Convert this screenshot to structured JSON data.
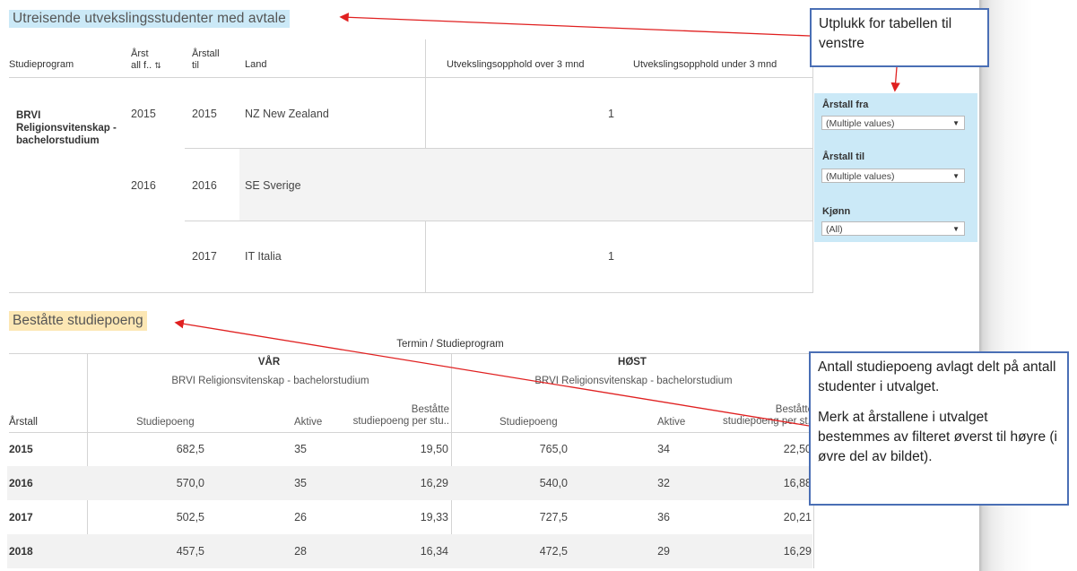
{
  "top": {
    "title": "Utreisende utvekslingsstudenter med avtale",
    "headers": {
      "studieprogram": "Studieprogram",
      "arstall_fra_l1": "Årst",
      "arstall_fra_l2": "all f..",
      "arstall_til_l1": "Årstall",
      "arstall_til_l2": "til",
      "land": "Land",
      "over3": "Utvekslingsopphold over 3 mnd",
      "under3": "Utvekslingsopphold under 3 mnd"
    },
    "program_l1": "BRVI",
    "program_l2": "Religionsvitenskap -",
    "program_l3": "bachelorstudium",
    "rows": [
      {
        "fra": "2015",
        "til": "2015",
        "land": "NZ New Zealand",
        "over3": "1",
        "under3": ""
      },
      {
        "fra": "2016",
        "til": "2016",
        "land": "SE Sverige",
        "over3": "",
        "under3": ""
      },
      {
        "fra": "",
        "til": "2017",
        "land": "IT Italia",
        "over3": "1",
        "under3": ""
      }
    ]
  },
  "filters": {
    "arstall_fra": {
      "label": "Årstall fra",
      "value": "(Multiple values)"
    },
    "arstall_til": {
      "label": "Årstall til",
      "value": "(Multiple values)"
    },
    "kjonn": {
      "label": "Kjønn",
      "value": "(All)"
    }
  },
  "bottom": {
    "title": "Beståtte studiepoeng",
    "super_header": "Termin / Studieprogram",
    "var": "VÅR",
    "host": "HØST",
    "program": "BRVI Religionsvitenskap - bachelorstudium",
    "col_arstall": "Årstall",
    "col_studiepoeng": "Studiepoeng",
    "col_aktive": "Aktive",
    "col_bestatte_l1": "Beståtte",
    "col_bestatte_l2": "studiepoeng per stu..",
    "col_bestatte_l2b": "studiepoeng per st..",
    "rows": [
      {
        "year": "2015",
        "v_sp": "682,5",
        "v_akt": "35",
        "v_per": "19,50",
        "h_sp": "765,0",
        "h_akt": "34",
        "h_per": "22,50"
      },
      {
        "year": "2016",
        "v_sp": "570,0",
        "v_akt": "35",
        "v_per": "16,29",
        "h_sp": "540,0",
        "h_akt": "32",
        "h_per": "16,88"
      },
      {
        "year": "2017",
        "v_sp": "502,5",
        "v_akt": "26",
        "v_per": "19,33",
        "h_sp": "727,5",
        "h_akt": "36",
        "h_per": "20,21"
      },
      {
        "year": "2018",
        "v_sp": "457,5",
        "v_akt": "28",
        "v_per": "16,34",
        "h_sp": "472,5",
        "h_akt": "29",
        "h_per": "16,29"
      }
    ]
  },
  "callouts": {
    "filter_note": "Utplukk for tabellen til venstre",
    "bottom_note_p1": "Antall studiepoeng avlagt delt på antall studenter i utvalget.",
    "bottom_note_p2": "Merk at årstallene i utvalget bestemmes av filteret øverst til høyre (i øvre del av bildet)."
  },
  "colors": {
    "title_blue_bg": "#cbe9f7",
    "title_yellow_bg": "#fce7b4",
    "callout_border": "#4a6fb5",
    "arrow": "#e02020"
  }
}
